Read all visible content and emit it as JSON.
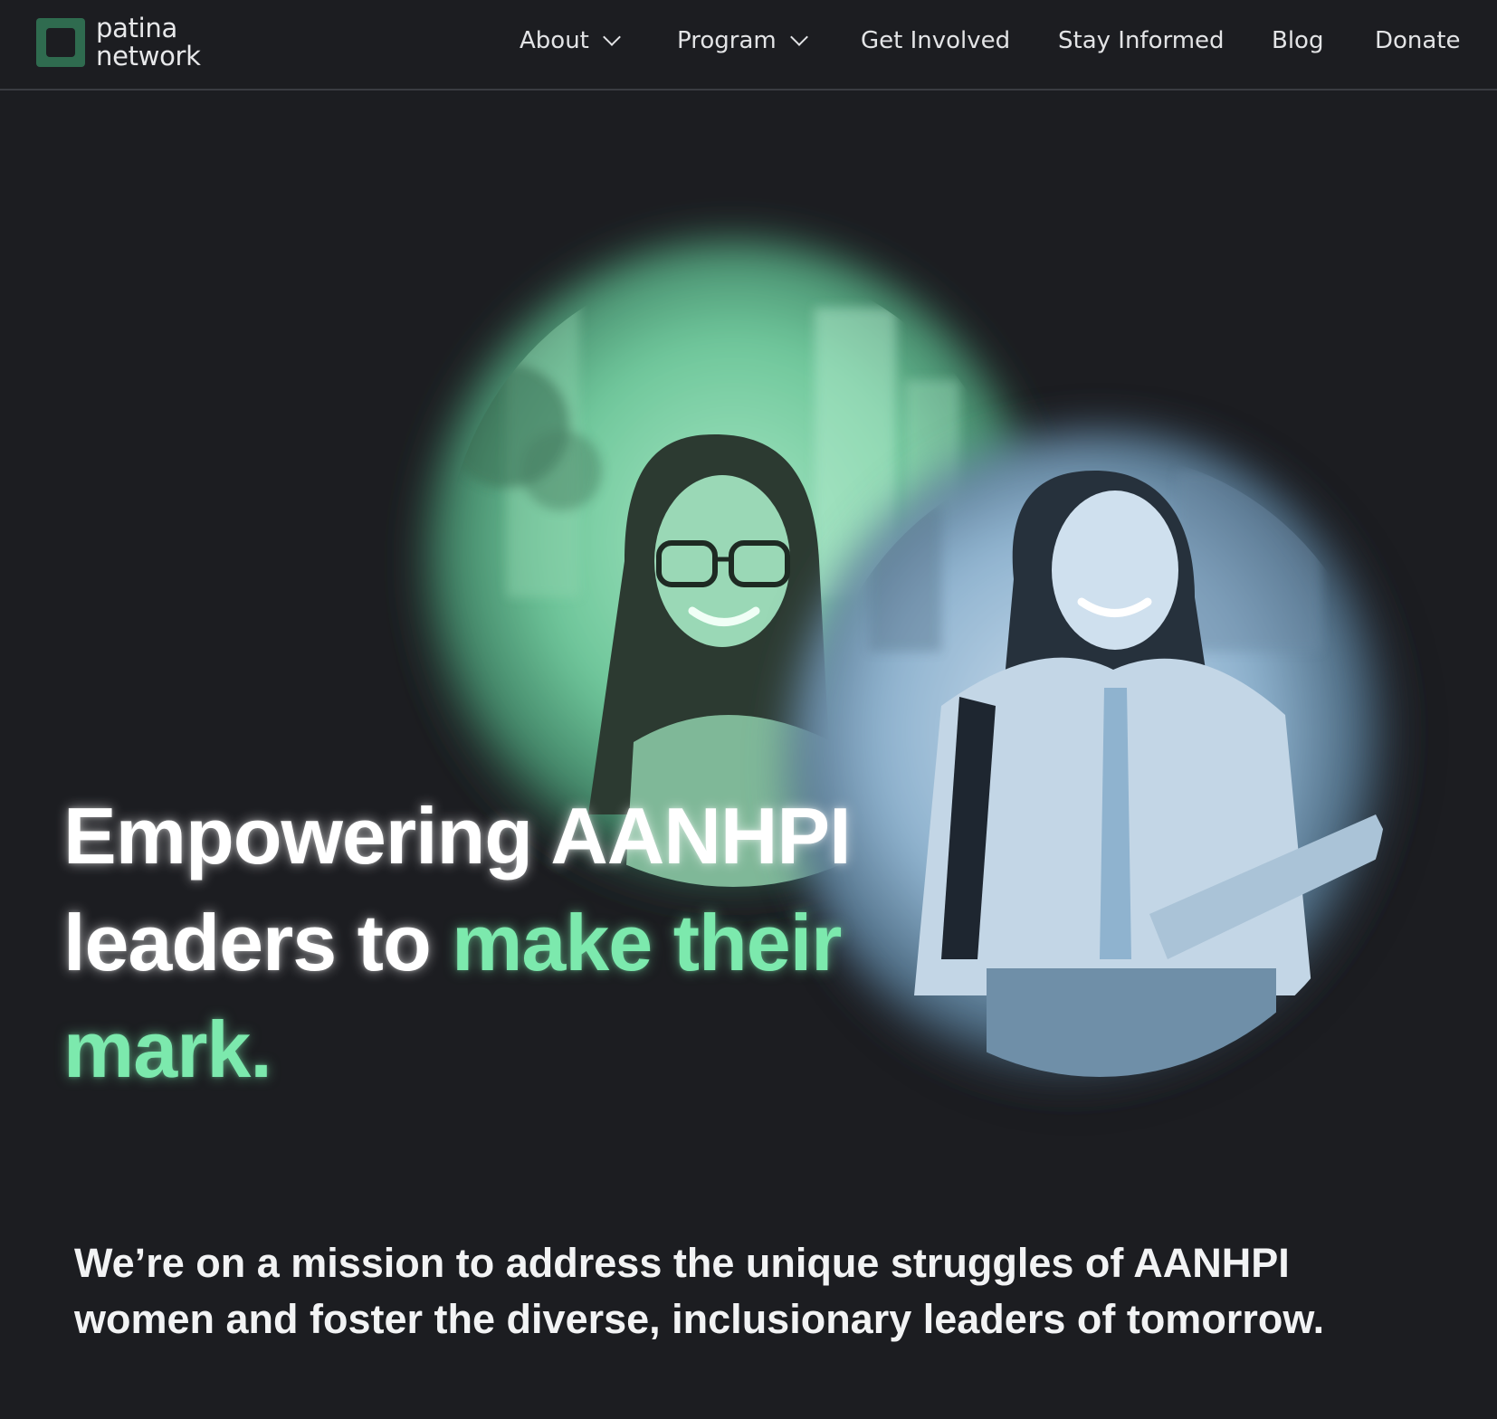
{
  "header": {
    "logo": {
      "line1": "patina",
      "line2": "network",
      "mark_color": "#2f6b4f"
    },
    "nav": {
      "about": "About",
      "program": "Program",
      "get_involved": "Get Involved",
      "stay_informed": "Stay Informed",
      "blog": "Blog",
      "donate": "Donate"
    }
  },
  "hero": {
    "headline_part1": "Empowering AANHPI leaders to ",
    "headline_accent": "make their mark.",
    "accent_color": "#7ce9ad",
    "image_description_icons": [
      "photo-woman-glasses",
      "photo-woman-jacket"
    ]
  },
  "mission": {
    "text": "We’re on a mission to address the unique struggles of AANHPI women and foster the diverse, inclusionary leaders of tomorrow."
  }
}
